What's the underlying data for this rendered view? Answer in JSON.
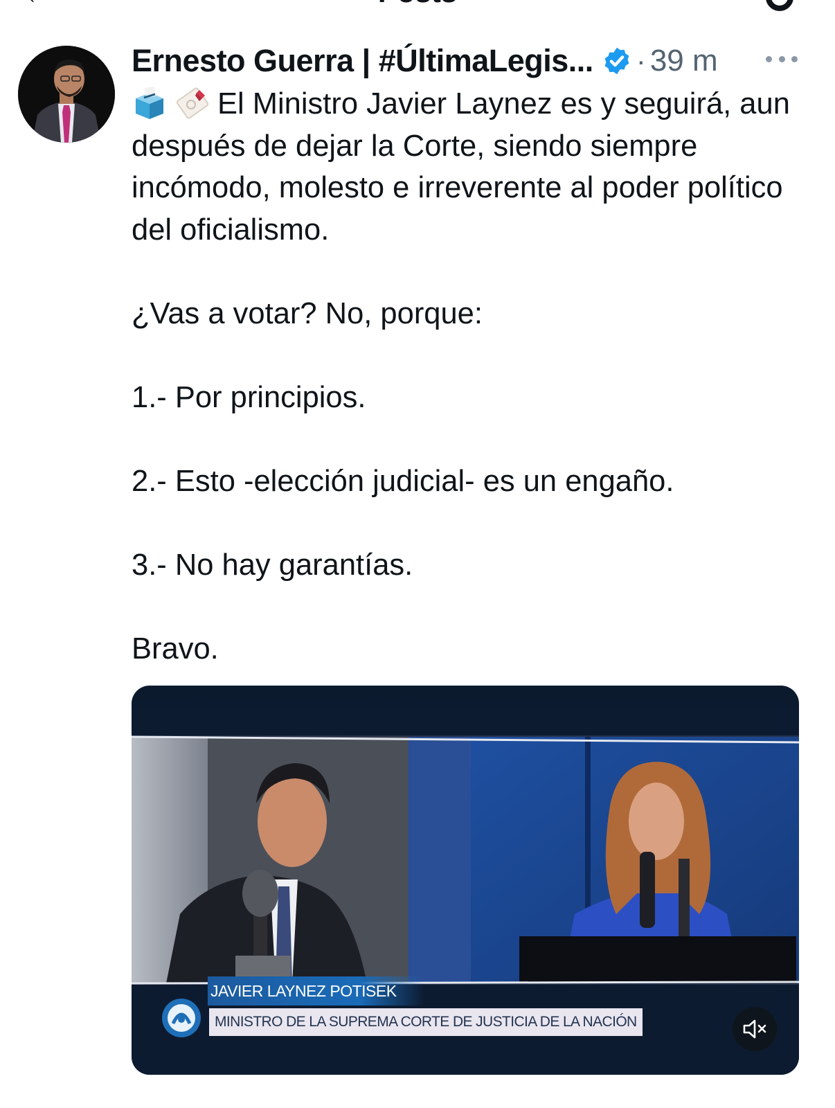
{
  "topbar": {
    "title": "Posts"
  },
  "post": {
    "display_name": "Ernesto Guerra | #ÚltimaLegis...",
    "separator": "·",
    "timestamp": "39 m",
    "emojis": [
      "ballot-box-icon",
      "ballot-card-icon"
    ],
    "body": {
      "line1": "El Ministro Javier Laynez es y seguirá, aun después de dejar la Corte, siendo siempre incómodo, molesto e irreverente al poder político del oficialismo.",
      "question": "¿Vas a votar? No, porque:",
      "item1": "1.- Por principios.",
      "item2": "2.- Esto -elección judicial- es un engaño.",
      "item3": "3.- No hay garantías.",
      "closing": "Bravo."
    },
    "video": {
      "caption_name": "JAVIER LAYNEZ POTISEK",
      "caption_title": "MINISTRO DE LA SUPREMA CORTE DE JUSTICIA DE LA NACIÓN",
      "muted": true
    }
  },
  "colors": {
    "text": "#0f1419",
    "secondary": "#536471",
    "verified": "#1d9bf0"
  }
}
